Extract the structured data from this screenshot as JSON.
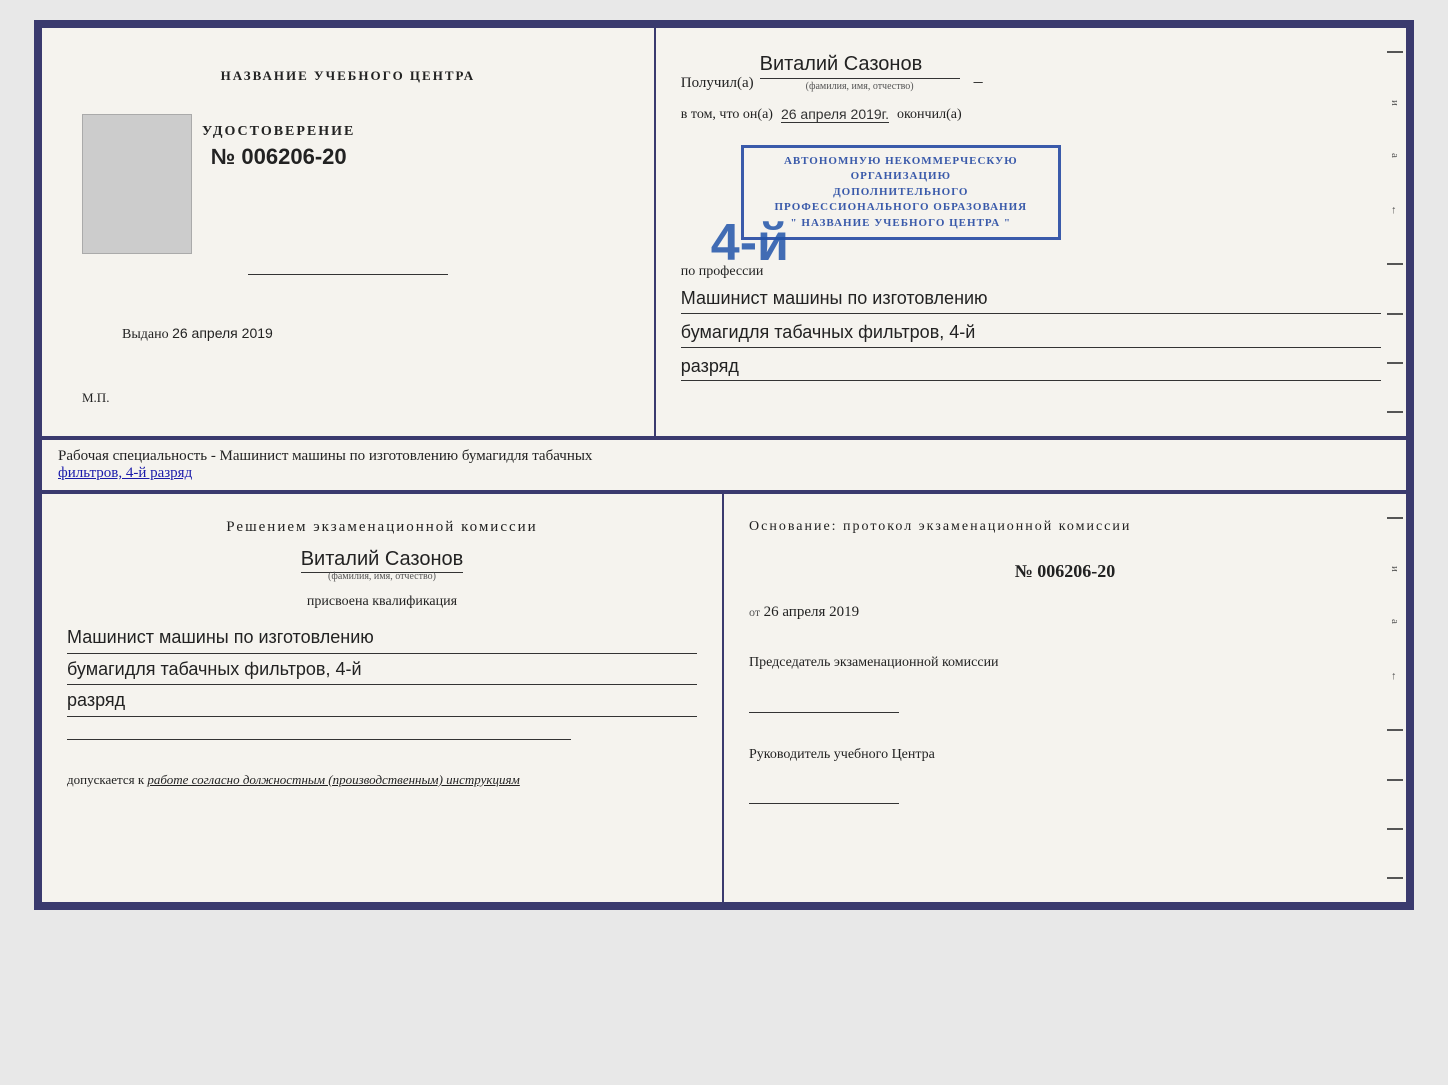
{
  "top_cert": {
    "left": {
      "title": "НАЗВАНИЕ УЧЕБНОГО ЦЕНТРА",
      "udost_label": "УДОСТОВЕРЕНИЕ",
      "number": "№ 006206-20",
      "issued_label": "Выдано",
      "issued_date": "26 апреля 2019",
      "mp_label": "М.П."
    },
    "right": {
      "poluchil_prefix": "Получил(а)",
      "name": "Виталий Сазонов",
      "name_sub": "(фамилия, имя, отчество)",
      "dash": "–",
      "vtom_prefix": "в том, что он(а)",
      "vtom_date": "26 апреля 2019г.",
      "okonchil": "окончил(а)",
      "big_number": "4-й",
      "stamp_line1": "АВТОНОМНУЮ НЕКОММЕРЧЕСКУЮ ОРГАНИЗАЦИЮ",
      "stamp_line2": "ДОПОЛНИТЕЛЬНОГО ПРОФЕССИОНАЛЬНОГО ОБРАЗОВАНИЯ",
      "stamp_line3": "\" НАЗВАНИЕ УЧЕБНОГО ЦЕНТРА \"",
      "profession_label": "по профессии",
      "profession1": "Машинист машины по изготовлению",
      "profession2": "бумагидля табачных фильтров, 4-й",
      "profession3": "разряд",
      "side_letters": [
        "и",
        "а",
        "←",
        "–",
        "–",
        "–",
        "–"
      ]
    }
  },
  "between": {
    "text_normal": "Рабочая специальность - Машинист машины по изготовлению бумагидля табачных",
    "text_underline": "фильтров, 4-й разряд"
  },
  "bottom_cert": {
    "left": {
      "komissia_title": "Решением  экзаменационной  комиссии",
      "name": "Виталий Сазонов",
      "name_sub": "(фамилия, имя, отчество)",
      "prisvoena_label": "присвоена квалификация",
      "profession1": "Машинист машины по изготовлению",
      "profession2": "бумагидля табачных фильтров, 4-й",
      "profession3": "разряд",
      "dopuskaetsya_prefix": "допускается к",
      "dopuskaetsya_text": "работе согласно должностным (производственным) инструкциям"
    },
    "right": {
      "osnovanie_title": "Основание: протокол экзаменационной  комиссии",
      "proto_number": "№  006206-20",
      "ot_label": "от",
      "ot_date": "26 апреля 2019",
      "predsedatel_label": "Председатель экзаменационной комиссии",
      "rukovoditel_label": "Руководитель учебного Центра",
      "side_letters": [
        "и",
        "а",
        "←",
        "–",
        "–",
        "–",
        "–"
      ]
    }
  }
}
